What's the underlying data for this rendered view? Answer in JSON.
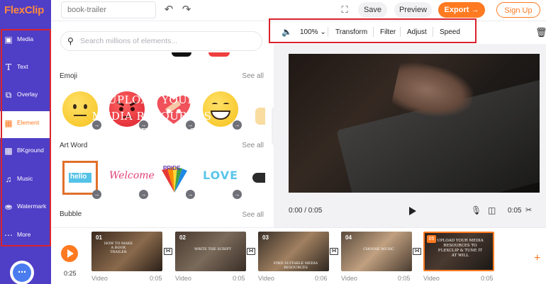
{
  "app": {
    "logo": "FlexClip"
  },
  "topbar": {
    "project_name": "book-trailer",
    "save_label": "Save",
    "preview_label": "Preview",
    "export_label": "Export",
    "signup_label": "Sign Up"
  },
  "sidebar": {
    "items": [
      {
        "label": "Media",
        "icon": "media-icon"
      },
      {
        "label": "Text",
        "icon": "text-icon"
      },
      {
        "label": "Overlay",
        "icon": "overlay-icon"
      },
      {
        "label": "Element",
        "icon": "element-icon",
        "active": true
      },
      {
        "label": "BKground",
        "icon": "background-icon"
      },
      {
        "label": "Music",
        "icon": "music-icon"
      },
      {
        "label": "Watermark",
        "icon": "watermark-icon"
      },
      {
        "label": "More",
        "icon": "more-icon"
      }
    ]
  },
  "panel": {
    "search_placeholder": "Search millions of elements...",
    "sections": [
      {
        "title": "Emoji",
        "see_all": "See all"
      },
      {
        "title": "Art Word",
        "see_all": "See all"
      },
      {
        "title": "Bubble",
        "see_all": "See all"
      }
    ],
    "art_words": [
      "hello",
      "Welcome",
      "PRIDE",
      "LOVE"
    ]
  },
  "preview_toolbar": {
    "volume_icon": "volume-icon",
    "zoom": "100%",
    "transform_label": "Transform",
    "filter_label": "Filter",
    "adjust_label": "Adjust",
    "speed_label": "Speed"
  },
  "video": {
    "overlay_lines": [
      "UPLOAD YOUR",
      "MEDIA RESOURCES",
      "TO FLEXCLIP &",
      "TUNE IT AT WILL"
    ],
    "time_current": "0:00 / 0:05",
    "duration": "0:05"
  },
  "timeline": {
    "total_duration": "0:25",
    "clips": [
      {
        "number": "01",
        "caption": "HOW TO MAKE A BOOK TRAILER",
        "type": "Video",
        "duration": "0:05"
      },
      {
        "number": "02",
        "caption": "WRITE THE SCRIPT",
        "type": "Video",
        "duration": "0:05"
      },
      {
        "number": "03",
        "caption": "FIND SUITABLE MEDIA RESOURCES",
        "type": "Video",
        "duration": "0:06"
      },
      {
        "number": "04",
        "caption": "CHOOSE MUSIC",
        "type": "Video",
        "duration": "0:05"
      },
      {
        "number": "05",
        "caption": "UPLOAD YOUR MEDIA RESOURCES TO FLEXCLIP & TUNE IT AT WILL",
        "type": "Video",
        "duration": "0:05"
      }
    ]
  },
  "colors": {
    "sidebar": "#4f3ec6",
    "accent": "#ff7a21",
    "highlight_box": "#d9232d"
  }
}
